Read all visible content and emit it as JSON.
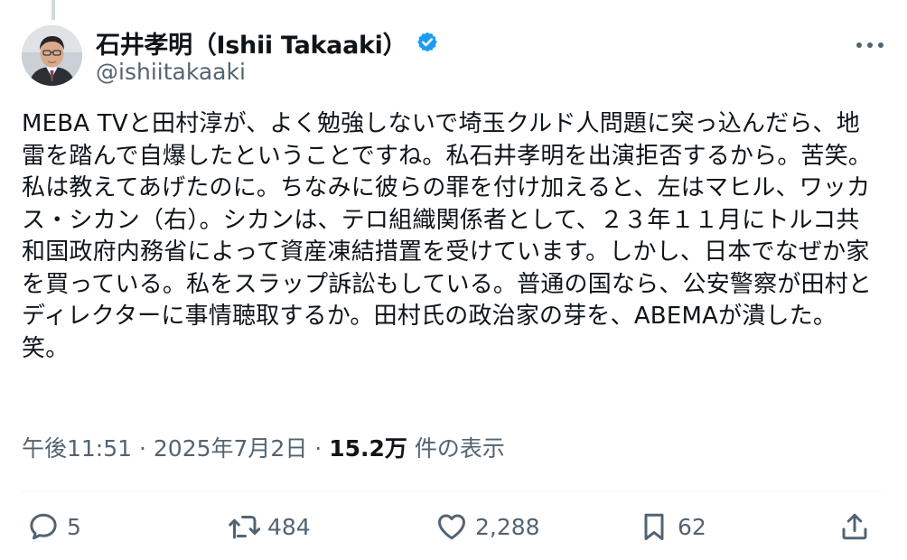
{
  "author": {
    "display_name": "石井孝明（Ishii Takaaki）",
    "handle": "@ishiitakaaki",
    "verified_icon": "verified-badge-icon",
    "avatar_icon": "profile-avatar"
  },
  "tweet": {
    "text": "MEBA TVと田村淳が、よく勉強しないで埼玉クルド人問題に突っ込んだら、地雷を踏んで自爆したということですね。私石井孝明を出演拒否するから。苦笑。私は教えてあげたのに。ちなみに彼らの罪を付け加えると、左はマヒル、ワッカス・シカン（右）。シカンは、テロ組織関係者として、２３年１１月にトルコ共和国政府内務省によって資産凍結措置を受けています。しかし、日本でなぜか家を買っている。私をスラップ訴訟もしている。普通の国なら、公安警察が田村とディレクターに事情聴取するか。田村氏の政治家の芽を、ABEMAが潰した。笑。"
  },
  "meta": {
    "time": "午後11:51",
    "separator": "·",
    "date": "2025年7月2日",
    "views_count": "15.2万",
    "views_label": "件の表示"
  },
  "actions": {
    "replies": "5",
    "reposts": "484",
    "likes": "2,288",
    "bookmarks": "62"
  },
  "colors": {
    "text": "#0f1419",
    "secondary": "#536471",
    "verified": "#1d9bf0",
    "divider": "#eff3f4"
  }
}
